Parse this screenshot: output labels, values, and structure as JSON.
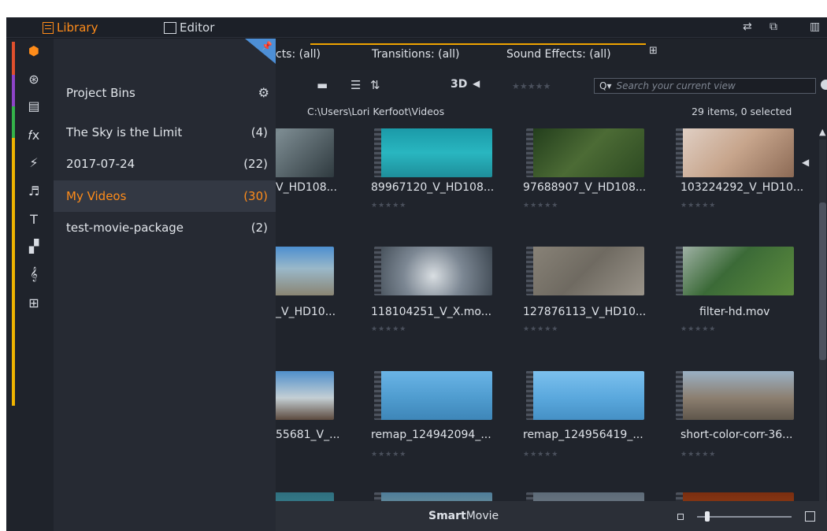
{
  "topbar": {
    "library_label": "Library",
    "editor_label": "Editor",
    "right_icons": [
      "swap-arrows-icon",
      "restore-window-icon",
      "panel-layout-icon"
    ]
  },
  "rail": {
    "accent_colors": [
      "#e0502d",
      "#8e44c9",
      "#34b34a",
      "#f0b400"
    ],
    "items": [
      {
        "name": "project-bins-icon",
        "glyph": "⬢",
        "color": "#ff8c1a"
      },
      {
        "name": "film-reel-icon",
        "glyph": "⊛"
      },
      {
        "name": "collections-icon",
        "glyph": "▤"
      },
      {
        "name": "effects-icon",
        "glyph": "𝑓x"
      },
      {
        "name": "transitions-icon",
        "glyph": "⚡"
      },
      {
        "name": "music-icon",
        "glyph": "♬"
      },
      {
        "name": "titles-icon",
        "glyph": "T"
      },
      {
        "name": "montage-icon",
        "glyph": "▞"
      },
      {
        "name": "score-icon",
        "glyph": "𝄞"
      },
      {
        "name": "instruments-icon",
        "glyph": "⊞"
      }
    ]
  },
  "bins": {
    "heading": "Project Bins",
    "items": [
      {
        "label": "The Sky is the Limit",
        "count": "(4)"
      },
      {
        "label": "2017-07-24",
        "count": "(22)"
      },
      {
        "label": "My Videos",
        "count": "(30)",
        "selected": true
      },
      {
        "label": "test-movie-package",
        "count": "(2)"
      }
    ]
  },
  "tabs": [
    {
      "label": "cts: (all)"
    },
    {
      "label": "Transitions: (all)"
    },
    {
      "label": "Sound Effects: (all)"
    }
  ],
  "toolbar": {
    "three_d_label": "3D",
    "rating_placeholder": "★★★★★",
    "search_placeholder": "Search your current view",
    "search_prefix": "Q▾"
  },
  "pathbar": {
    "path": "C:\\Users\\Lori Kerfoot\\Videos",
    "count": "29 items, 0 selected"
  },
  "grid": {
    "rows": [
      [
        {
          "name": "V_HD108...",
          "gradient": "linear-gradient(135deg,#3f4a52 0%,#7b8a90 40%,#2f3a3f 100%)"
        },
        {
          "name": "89967120_V_HD108...",
          "gradient": "linear-gradient(180deg,#1b9aa8 0%,#29b6c0 50%,#1e8e9a 100%)"
        },
        {
          "name": "97688907_V_HD108...",
          "gradient": "linear-gradient(135deg,#1f3a1a 0%,#4c6b35 50%,#2d4a22 100%)"
        },
        {
          "name": "103224292_V_HD10...",
          "gradient": "linear-gradient(135deg,#e2d3c9 0%,#c7a58c 50%,#8c6a55 100%)"
        }
      ],
      [
        {
          "name": "_V_HD10...",
          "gradient": "linear-gradient(180deg,#4d8fd0 0%,#9ab8c9 45%,#8a8573 100%)"
        },
        {
          "name": "118104251_V_X.mo...",
          "gradient": "radial-gradient(circle at 50% 60%,#d9dee2 0%,#7c8793 45%,#3c4650 100%)"
        },
        {
          "name": "127876113_V_HD10...",
          "gradient": "linear-gradient(135deg,#8a8479 0%,#6f6a61 50%,#9a948a 100%)"
        },
        {
          "name": "filter-hd.mov",
          "gradient": "linear-gradient(135deg,#a9b8b0 0%,#3b6a37 45%,#5d8c3e 100%)"
        }
      ],
      [
        {
          "name": "55681_V_...",
          "gradient": "linear-gradient(180deg,#4f8fcb 0%,#c4cfd4 55%,#5c4a3e 100%)"
        },
        {
          "name": "remap_124942094_...",
          "gradient": "linear-gradient(180deg,#6ab4e6 0%,#4f9ccf 55%,#3e86b8 100%)"
        },
        {
          "name": "remap_124956419_...",
          "gradient": "linear-gradient(180deg,#7cc0ee 0%,#5aa8dd 55%,#4590c5 100%)"
        },
        {
          "name": "short-color-corr-36...",
          "gradient": "linear-gradient(180deg,#9ab0c4 0%,#8c7f70 55%,#5f564b 100%)"
        }
      ],
      [
        {
          "name": "",
          "gradient": "linear-gradient(180deg,#2f6f7f 0%,#47a0a6 100%)"
        },
        {
          "name": "",
          "gradient": "linear-gradient(180deg,#4e7c99 0%,#a6b89c 100%)"
        },
        {
          "name": "",
          "gradient": "linear-gradient(180deg,#5d6b78 0%,#8b9098 100%)"
        },
        {
          "name": "",
          "gradient": "linear-gradient(180deg,#7a2e10 0%,#b0541f 100%)"
        }
      ]
    ],
    "stars": "★★★★★"
  },
  "bottombar": {
    "smart_bold": "Smart",
    "smart_rest": "Movie"
  }
}
